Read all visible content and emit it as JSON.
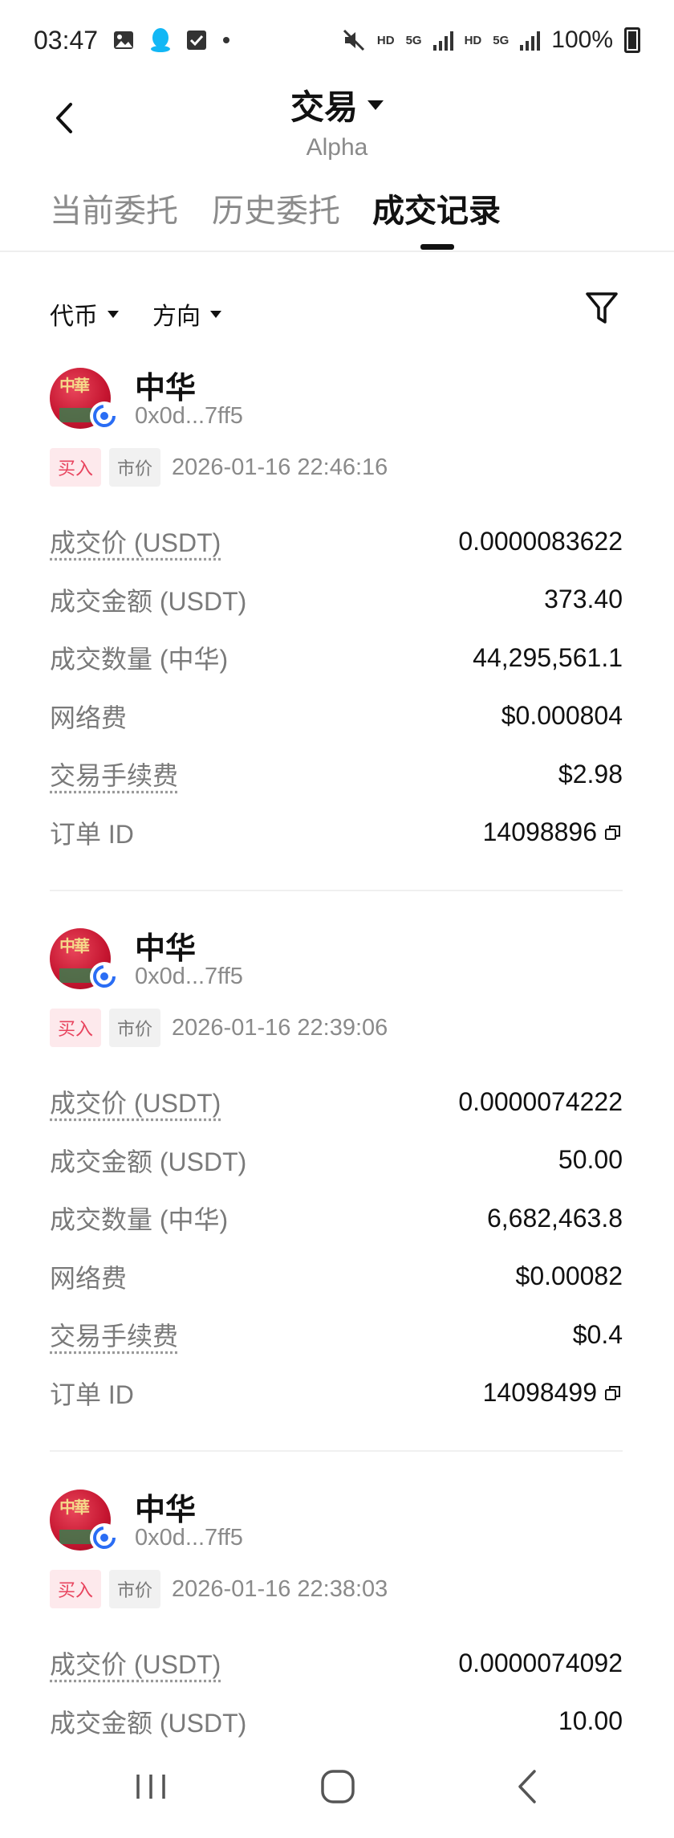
{
  "status": {
    "time": "03:47",
    "hd1": "HD",
    "net1": "5G",
    "hd2": "HD",
    "net2": "5G",
    "battery": "100%"
  },
  "header": {
    "title": "交易",
    "subtitle": "Alpha"
  },
  "tabs": [
    {
      "label": "当前委托"
    },
    {
      "label": "历史委托"
    },
    {
      "label": "成交记录"
    }
  ],
  "filters": {
    "token": "代币",
    "direction": "方向"
  },
  "trades": [
    {
      "coin_name": "中华",
      "address": "0x0d...7ff5",
      "side": "买入",
      "order_type": "市价",
      "time": "2026-01-16 22:46:16",
      "rows": [
        {
          "label": "成交价 (USDT)",
          "value": "0.0000083622"
        },
        {
          "label": "成交金额 (USDT)",
          "value": "373.40"
        },
        {
          "label": "成交数量 (中华)",
          "value": "44,295,561.1"
        },
        {
          "label": "网络费",
          "value": "$0.000804"
        },
        {
          "label": "交易手续费",
          "value": "$2.98"
        },
        {
          "label": "订单 ID",
          "value": "14098896"
        }
      ]
    },
    {
      "coin_name": "中华",
      "address": "0x0d...7ff5",
      "side": "买入",
      "order_type": "市价",
      "time": "2026-01-16 22:39:06",
      "rows": [
        {
          "label": "成交价 (USDT)",
          "value": "0.0000074222"
        },
        {
          "label": "成交金额 (USDT)",
          "value": "50.00"
        },
        {
          "label": "成交数量 (中华)",
          "value": "6,682,463.8"
        },
        {
          "label": "网络费",
          "value": "$0.00082"
        },
        {
          "label": "交易手续费",
          "value": "$0.4"
        },
        {
          "label": "订单 ID",
          "value": "14098499"
        }
      ]
    },
    {
      "coin_name": "中华",
      "address": "0x0d...7ff5",
      "side": "买入",
      "order_type": "市价",
      "time": "2026-01-16 22:38:03",
      "rows": [
        {
          "label": "成交价 (USDT)",
          "value": "0.0000074092"
        },
        {
          "label": "成交金额 (USDT)",
          "value": "10.00"
        }
      ]
    }
  ]
}
